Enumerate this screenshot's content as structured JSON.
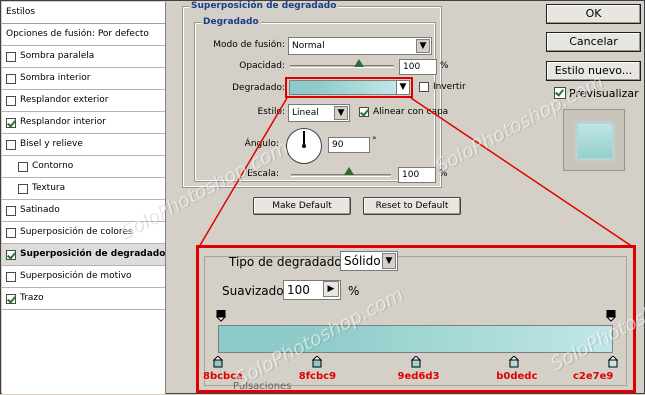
{
  "styles_panel": {
    "header": "Estilos",
    "items": [
      {
        "label": "Opciones de fusión: Por defecto",
        "checkbox": false,
        "checked": false,
        "indent": false,
        "selected": false
      },
      {
        "label": "Sombra paralela",
        "checkbox": true,
        "checked": false,
        "indent": false,
        "selected": false
      },
      {
        "label": "Sombra interior",
        "checkbox": true,
        "checked": false,
        "indent": false,
        "selected": false
      },
      {
        "label": "Resplandor exterior",
        "checkbox": true,
        "checked": false,
        "indent": false,
        "selected": false
      },
      {
        "label": "Resplandor interior",
        "checkbox": true,
        "checked": true,
        "indent": false,
        "selected": false
      },
      {
        "label": "Bisel y relieve",
        "checkbox": true,
        "checked": false,
        "indent": false,
        "selected": false
      },
      {
        "label": "Contorno",
        "checkbox": true,
        "checked": false,
        "indent": true,
        "selected": false
      },
      {
        "label": "Textura",
        "checkbox": true,
        "checked": false,
        "indent": true,
        "selected": false
      },
      {
        "label": "Satinado",
        "checkbox": true,
        "checked": false,
        "indent": false,
        "selected": false
      },
      {
        "label": "Superposición de colores",
        "checkbox": true,
        "checked": false,
        "indent": false,
        "selected": false
      },
      {
        "label": "Superposición de degradado",
        "checkbox": true,
        "checked": true,
        "indent": false,
        "selected": true
      },
      {
        "label": "Superposición de motivo",
        "checkbox": true,
        "checked": false,
        "indent": false,
        "selected": false
      },
      {
        "label": "Trazo",
        "checkbox": true,
        "checked": true,
        "indent": false,
        "selected": false
      }
    ]
  },
  "settings": {
    "outer_title": "Superposición de degradado",
    "inner_title": "Degradado",
    "blend_mode_label": "Modo de fusión:",
    "blend_mode_value": "Normal",
    "opacity_label": "Opacidad:",
    "opacity_value": "100",
    "opacity_unit": "%",
    "opacity_level": 1.0,
    "gradient_label": "Degradado:",
    "invert_label": "Invertir",
    "style_label": "Estilo:",
    "style_value": "Lineal",
    "align_label": "Alinear con capa",
    "angle_label": "Ángulo:",
    "angle_value": "90",
    "angle_unit": "°",
    "scale_label": "Escala:",
    "scale_value": "100",
    "scale_unit": "%",
    "scale_level": 1.0,
    "make_default": "Make Default",
    "reset_default": "Reset to Default"
  },
  "zoom_panel": {
    "gradient_type_label": "Tipo de degradado:",
    "gradient_type_value": "Sólido",
    "smoothness_label": "Suavizado:",
    "smoothness_value": "100",
    "smoothness_unit": "%",
    "color_stops": [
      "8bcbca",
      "8fcbc9",
      "9ed6d3",
      "b0dedc",
      "c2e7e9"
    ],
    "partial_label": "Pulsaciones"
  },
  "right_buttons": {
    "ok": "OK",
    "cancel": "Cancelar",
    "new_style": "Estilo nuevo...",
    "preview_label": "Previsualizar",
    "preview_checked": true
  },
  "watermark": "SoloPhotoshop.com",
  "colors": {
    "accent_title": "#1a3c8a",
    "highlight_red": "#e00000",
    "check_green": "#2a6f2a",
    "gradient": [
      "#8bcbca",
      "#8fcbc9",
      "#9ed6d3",
      "#b0dedc",
      "#c2e7e9"
    ]
  }
}
